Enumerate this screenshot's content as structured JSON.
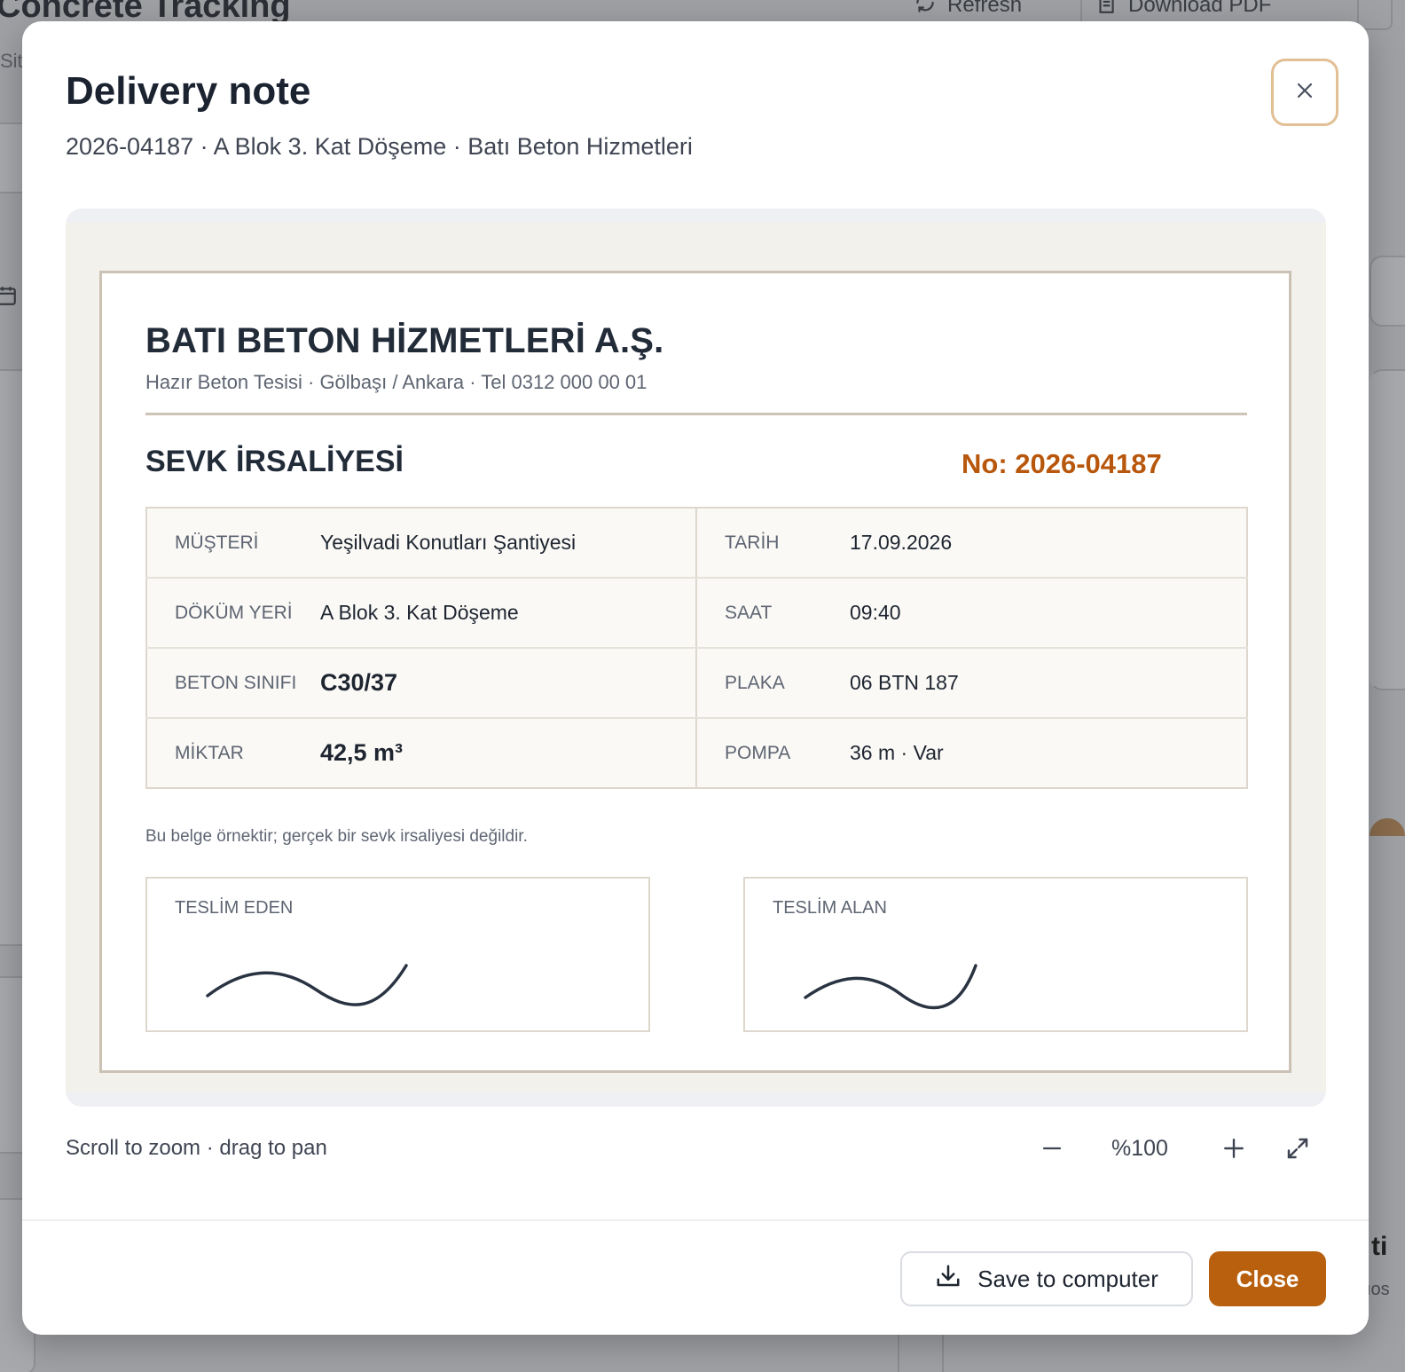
{
  "background": {
    "app_title": "Concrete Tracking",
    "subtitle_fragment": "Sit",
    "refresh_label": "Refresh",
    "download_pdf_label": "Download PDF",
    "fragment_right": "ti",
    "fragment_right_small": "ıos"
  },
  "modal": {
    "title": "Delivery note",
    "subtitle": "2026-04187 · A Blok 3. Kat Döşeme · Batı Beton Hizmetleri",
    "hint": "Scroll to zoom · drag to pan",
    "zoom_level": "%100",
    "save_label": "Save to computer",
    "close_label": "Close"
  },
  "document": {
    "company": "BATI BETON HİZMETLERİ A.Ş.",
    "company_info": "Hazır Beton Tesisi · Gölbaşı / Ankara · Tel 0312 000 00 01",
    "title": "SEVK İRSALİYESİ",
    "number": "No: 2026-04187",
    "rows": [
      {
        "l1": "MÜŞTERİ",
        "v1": "Yeşilvadi Konutları Şantiyesi",
        "l2": "TARİH",
        "v2": "17.09.2026"
      },
      {
        "l1": "DÖKÜM YERİ",
        "v1": "A Blok 3. Kat Döşeme",
        "l2": "SAAT",
        "v2": "09:40"
      },
      {
        "l1": "BETON SINIFI",
        "v1": "C30/37",
        "l2": "PLAKA",
        "v2": "06 BTN 187"
      },
      {
        "l1": "MİKTAR",
        "v1": "42,5 m³",
        "l2": "POMPA",
        "v2": "36 m · Var"
      }
    ],
    "note": "Bu belge örnektir; gerçek bir sevk irsaliyesi değildir.",
    "signature_left_label": "TESLİM EDEN",
    "signature_right_label": "TESLİM ALAN"
  },
  "colors": {
    "accent": "#b8600d",
    "doc_number": "#b8570c",
    "close_ring": "#e2bf95"
  },
  "icons": [
    "refresh-icon",
    "document-icon",
    "calendar-icon",
    "close-icon",
    "minus-icon",
    "plus-icon",
    "expand-icon",
    "download-icon"
  ]
}
